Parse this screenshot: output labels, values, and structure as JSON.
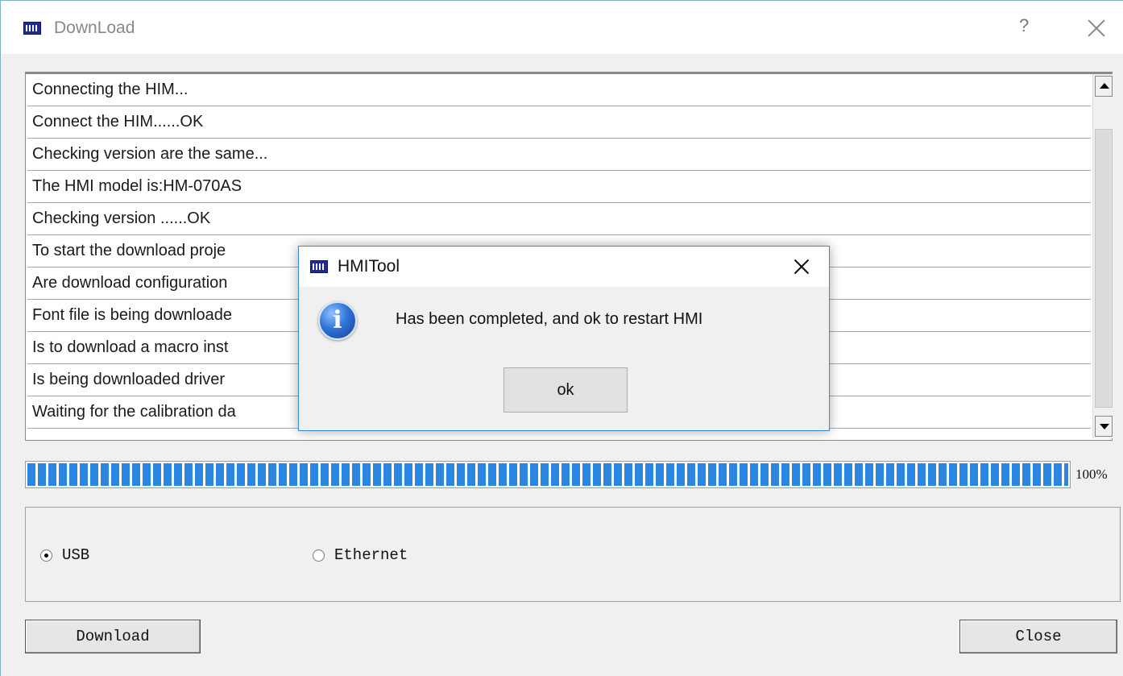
{
  "window": {
    "title": "DownLoad",
    "help_label": "?"
  },
  "log": {
    "lines": [
      "Connecting the HIM...",
      "Connect the HIM......OK",
      "Checking version are the same...",
      "The HMI model is:HM-070AS",
      "Checking version ......OK",
      "To start the download proje",
      "Are download configuration",
      "Font file is being downloade",
      "Is to download a macro inst",
      "Is being downloaded driver",
      "Waiting for the calibration da"
    ]
  },
  "progress": {
    "value": 1.0,
    "percent_label": "100%",
    "color": "#2a86e0"
  },
  "connection": {
    "options": [
      "USB",
      "Ethernet"
    ],
    "selected": "USB"
  },
  "buttons": {
    "download": "Download",
    "close": "Close"
  },
  "dialog": {
    "title": "HMITool",
    "message": "Has been completed, and ok to restart HMI",
    "ok_label": "ok",
    "icon": "info-icon"
  }
}
